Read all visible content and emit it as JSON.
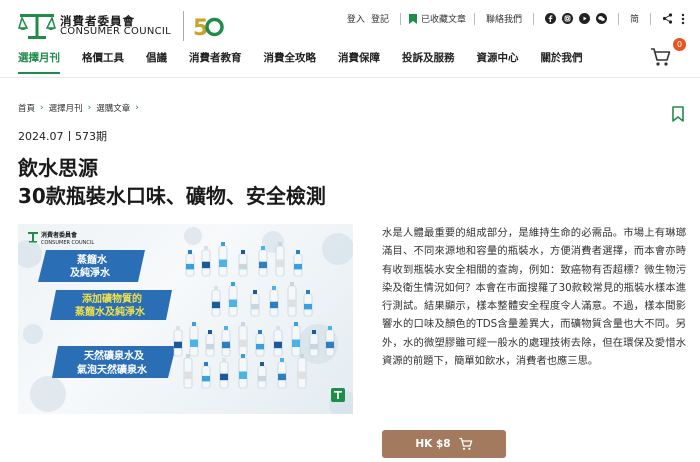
{
  "brand": {
    "name_cn": "消費者委員會",
    "name_en": "CONSUMER COUNCIL",
    "anniversary": "50",
    "green": "#1f8c4a",
    "gold": "#c9a227"
  },
  "topbar": {
    "login": "登入",
    "register": "登記",
    "bookmarked": "已收藏文章",
    "contact": "聯絡我們",
    "social_icons": [
      "facebook-icon",
      "instagram-icon",
      "youtube-icon",
      "wechat-icon"
    ],
    "lang": "简",
    "share_icon": "share-icon",
    "menu_icon": "more-vertical-icon"
  },
  "nav": {
    "items": [
      "選擇月刊",
      "格價工具",
      "倡議",
      "消費者教育",
      "消費全攻略",
      "消費保障",
      "投訴及服務",
      "資源中心",
      "關於我們"
    ],
    "active_index": 0
  },
  "cart": {
    "count": "0",
    "accent": "#e8541e"
  },
  "breadcrumb": [
    "首頁",
    "選擇月刊",
    "選購文章"
  ],
  "article": {
    "date": "2024.07",
    "issue": "573期",
    "title_line1": "飲水思源",
    "title_line2": "30款瓶裝水口味、礦物、安全檢測",
    "description": "水是人體最重要的組成部分，是維持生命的必需品。市場上有琳瑯滿目、不同來源地和容量的瓶裝水，方便消費者選擇，而本會亦時有收到瓶裝水安全相關的查詢，例如：致癌物有否超標？微生物污染及衛生情況如何？本會在市面搜羅了30款較常見的瓶裝水樣本進行測試。結果顯示，樣本整體安全程度令人滿意。不過，樣本間影響水的口味及顏色的TDS含量差異大，而礦物質含量也大不同。另外，水的微塑膠雖可經一般水的處理技術去除，但在環保及愛惜水資源的前題下，簡單如飲水，消費者也應三思。",
    "cover": {
      "logo_cn": "消費者委員會",
      "logo_en": "CONSUMER COUNCIL",
      "label1_line1": "蒸餾水",
      "label1_line2": "及純淨水",
      "label2_line1": "添加礦物質的",
      "label2_line2": "蒸餾水及純淨水",
      "label3_line1": "天然礦泉水及",
      "label3_line2": "氣泡天然礦泉水"
    },
    "price_label": "HK $8",
    "button_color": "#a37a5d"
  }
}
